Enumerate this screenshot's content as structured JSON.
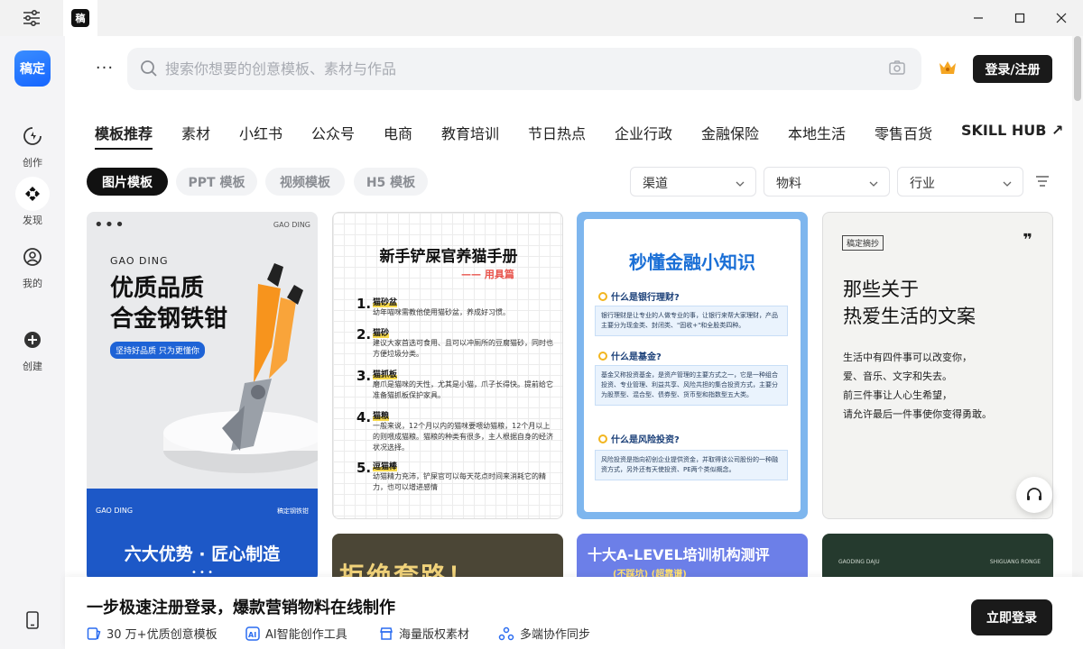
{
  "app": {
    "favicon_text": "稿",
    "logo_text": "稿定"
  },
  "sidebar": {
    "items": [
      {
        "label": "创作",
        "icon": "create-icon"
      },
      {
        "label": "发现",
        "icon": "discover-icon"
      },
      {
        "label": "我的",
        "icon": "user-icon"
      },
      {
        "label": "创建",
        "icon": "plus-circle-icon"
      }
    ]
  },
  "header": {
    "more": "···",
    "search_placeholder": "搜索你想要的创意模板、素材与作品",
    "login_label": "登录/注册"
  },
  "categories": [
    "模板推荐",
    "素材",
    "小红书",
    "公众号",
    "电商",
    "教育培训",
    "节日热点",
    "企业行政",
    "金融保险",
    "本地生活",
    "零售百货",
    "SKILL HUB ↗"
  ],
  "sub_tabs": [
    "图片模板",
    "PPT 模板",
    "视频模板",
    "H5 模板"
  ],
  "filters": [
    "渠道",
    "物料",
    "行业"
  ],
  "cards": {
    "c1": {
      "dots": "•••",
      "brand": "GAO DING",
      "sub": "GAO DING",
      "title_line1": "优质品质",
      "title_line2": "合金钢铁钳",
      "tag": "坚持好品质 只为更懂你",
      "bottom_brand": "GAO DING",
      "bottom_right": "稿定钢铁钳",
      "bottom_title": "六大优势 · 匠心制造",
      "bottom_dots": "• • •"
    },
    "c2": {
      "title": "新手铲屎官养猫手册",
      "sub": "—— 用具篇",
      "items": [
        {
          "num": "1.",
          "head": "猫砂盆",
          "text": "幼年喵咪需教他使用猫砂盆，养成好习惯。"
        },
        {
          "num": "2.",
          "head": "猫砂",
          "text": "建议大家首选可食用、且可以冲厕所的豆腐猫砂，同时也方便垃圾分类。"
        },
        {
          "num": "3.",
          "head": "猫抓板",
          "text": "磨爪是猫咪的天性，尤其是小猫，爪子长得快。提前给它准备猫抓板保护家具。"
        },
        {
          "num": "4.",
          "head": "猫粮",
          "text": "一般来说，12个月以内的猫咪要喂幼猫粮，12个月以上的则喂成猫粮。猫粮的种类有很多，主人根据自身的经济状况选择。"
        },
        {
          "num": "5.",
          "head": "逗猫棒",
          "text": "幼猫精力充沛，铲屎官可以每天花点时间来消耗它的精力，也可以增进感情"
        }
      ]
    },
    "c3": {
      "title": "秒懂金融小知识",
      "q1": "什么是银行理财?",
      "a1": "银行理财是让专业的人做专业的事，让银行来帮大家理财，产品主要分为现金类、封闭类、\"固收+\"和全股类四种。",
      "q2": "什么是基金?",
      "a2": "基金又称投资基金，是资产管理的主要方式之一，它是一种组合投资、专业管理、利益共享、风险共担的集合投资方式，主要分为股票型、混合型、债券型、货币型和指数型五大类。",
      "q3": "什么是风险投资?",
      "a3": "风险投资是指向初创企业提供资金，并取得该公司股份的一种融资方式，另外还有天使投资、PE两个类似概念。"
    },
    "c4": {
      "tag": "稿定摘抄",
      "quote": "❞",
      "title_line1": "那些关于",
      "title_line2": "热爱生活的文案",
      "body": [
        "生活中有四件事可以改变你，",
        "爱、音乐、文字和失去。",
        "前三件事让人心生希望，",
        "请允许最后一件事使你变得勇敢。"
      ]
    },
    "c5": {
      "text": "拒绝套路！"
    },
    "c6": {
      "text": "十大A-LEVEL培训机构测评",
      "sub": "(不踩坑)  (超靠谱)"
    },
    "c7": {
      "left": "GAODING DAJU",
      "right": "SHIGUANG RONGE"
    }
  },
  "banner": {
    "title": "一步极速注册登录，爆款营销物料在线制作",
    "features": [
      "30 万+优质创意模板",
      "AI智能创作工具",
      "海量版权素材",
      "多端协作同步"
    ],
    "button": "立即登录"
  }
}
